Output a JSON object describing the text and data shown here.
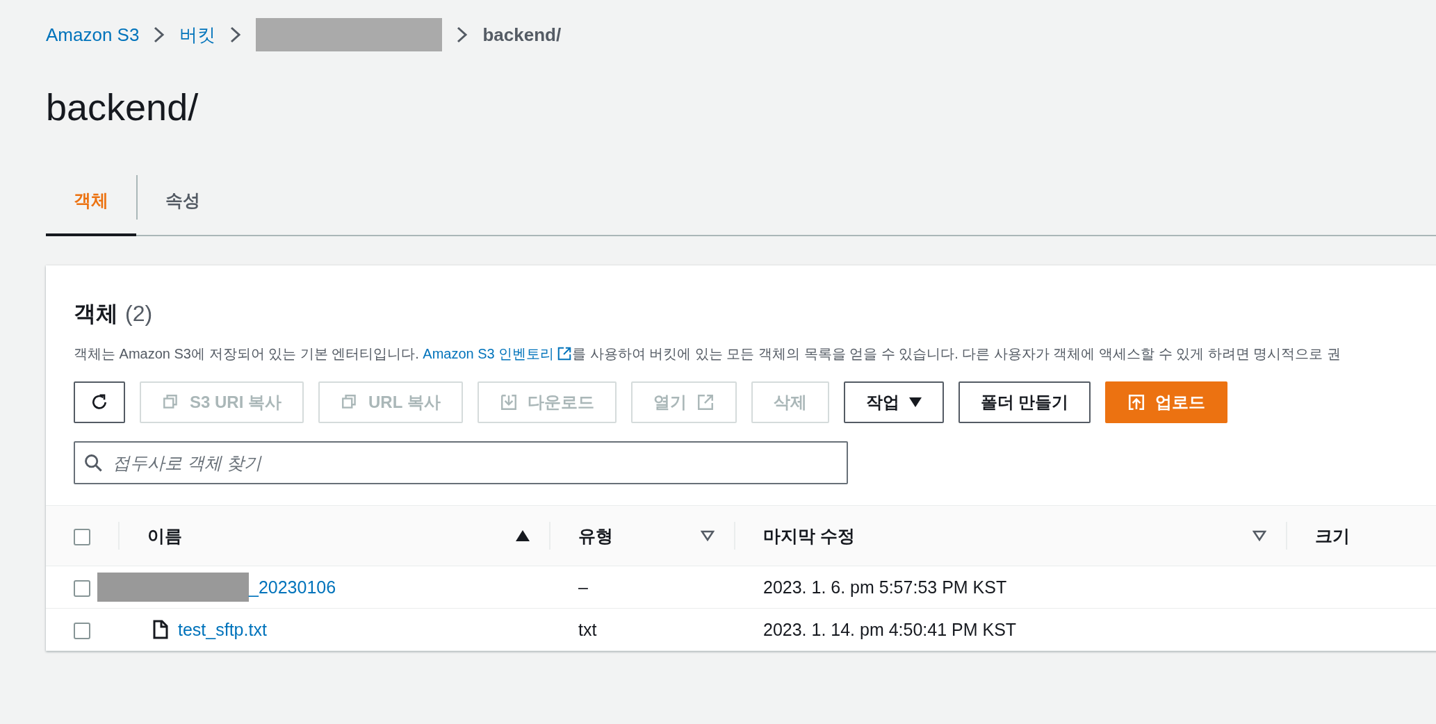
{
  "breadcrumbs": [
    {
      "label": "Amazon S3",
      "kind": "link"
    },
    {
      "label": "버킷",
      "kind": "link"
    },
    {
      "kind": "redacted"
    },
    {
      "label": "backend/",
      "kind": "current"
    }
  ],
  "title": "backend/",
  "tabs": [
    {
      "label": "객체",
      "selected": true
    },
    {
      "label": "속성",
      "selected": false
    }
  ],
  "panel": {
    "heading": "객체",
    "count": "(2)",
    "description_before": "객체는 Amazon S3에 저장되어 있는 기본 엔터티입니다.",
    "description_link": "Amazon S3 인벤토리",
    "description_after": "를 사용하여 버킷에 있는 모든 객체의 목록을 얻을 수 있습니다. 다른 사용자가 객체에 액세스할 수 있게 하려면 명시적으로 권",
    "toolbar": [
      {
        "kind": "refresh",
        "disabled": false
      },
      {
        "kind": "copy",
        "label": "S3 URI 복사",
        "disabled": true
      },
      {
        "kind": "copy",
        "label": "URL 복사",
        "disabled": true
      },
      {
        "kind": "download",
        "label": "다운로드",
        "disabled": true
      },
      {
        "kind": "open",
        "label": "열기",
        "disabled": true
      },
      {
        "kind": "plain",
        "label": "삭제",
        "disabled": true
      },
      {
        "kind": "dropdown",
        "label": "작업",
        "disabled": false
      },
      {
        "kind": "plain",
        "label": "폴더 만들기",
        "disabled": false
      },
      {
        "kind": "upload",
        "label": "업로드",
        "disabled": false
      }
    ],
    "search": {
      "placeholder": "접두사로 객체 찾기"
    },
    "table": {
      "all_selected": false,
      "columns": [
        {
          "label": "이름",
          "sorted": true
        },
        {
          "label": "유형",
          "sorted": false
        },
        {
          "label": "마지막 수정",
          "sorted": false
        },
        {
          "label": "크기"
        }
      ],
      "rows": [
        {
          "checked": false,
          "kind": "folder",
          "name": "_20230106",
          "type": "–",
          "modified": "2023. 1. 6. pm 5:57:53 PM KST"
        },
        {
          "checked": false,
          "kind": "file",
          "name": "test_sftp.txt",
          "type": "txt",
          "modified": "2023. 1. 14. pm 4:50:41 PM KST"
        }
      ]
    }
  }
}
